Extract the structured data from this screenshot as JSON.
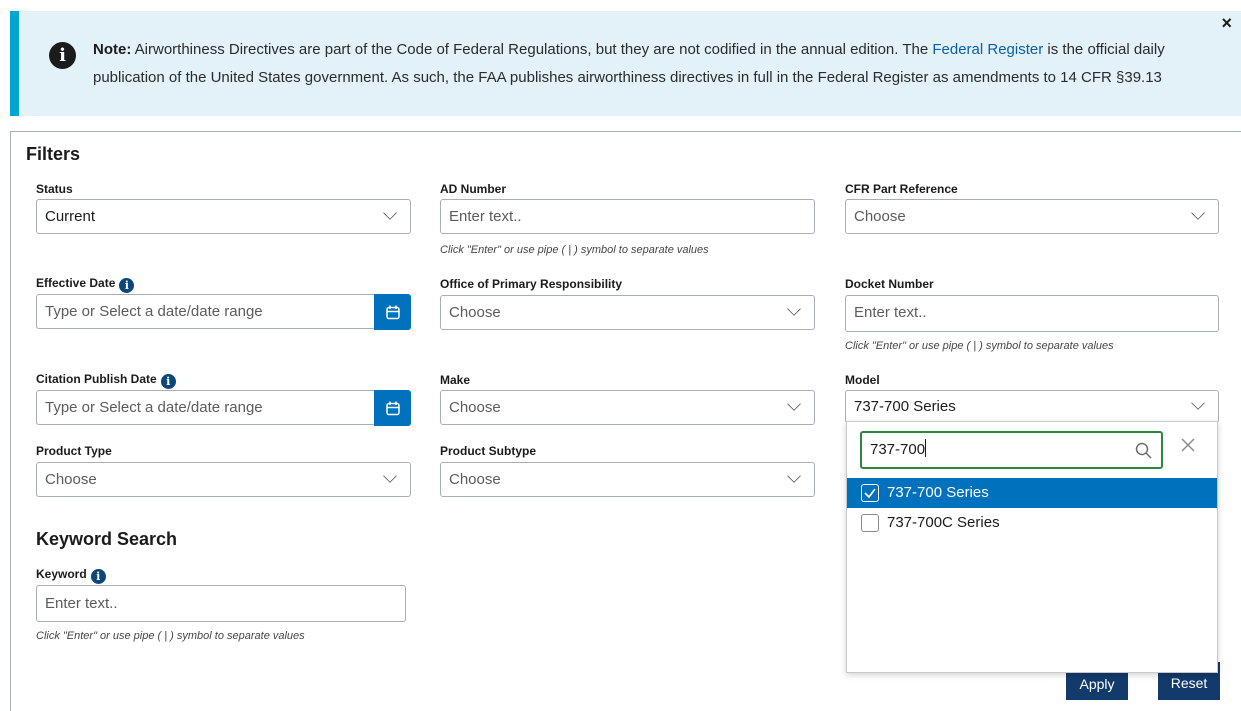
{
  "note": {
    "label": "Note:",
    "text_1": "Airworthiness Directives are part of the Code of Federal Regulations, but they are not codified in the annual edition. The",
    "link": "Federal Register",
    "text_2": "is the official daily publication of the United States government. As such, the FAA publishes airworthiness directives in full in the Federal Register as amendments to 14 CFR §39.13",
    "close": "×"
  },
  "filters": {
    "title": "Filters",
    "status": {
      "label": "Status",
      "value": "Current"
    },
    "ad_number": {
      "label": "AD Number",
      "placeholder": "Enter text..",
      "hint": "Click \"Enter\" or use pipe ( | ) symbol to separate values"
    },
    "cfr_part": {
      "label": "CFR Part Reference",
      "placeholder": "Choose"
    },
    "effective_date": {
      "label": "Effective Date",
      "placeholder": "Type or Select a date/date range"
    },
    "office": {
      "label": "Office of Primary Responsibility",
      "placeholder": "Choose"
    },
    "docket": {
      "label": "Docket Number",
      "placeholder": "Enter text..",
      "hint": "Click \"Enter\" or use pipe ( | ) symbol to separate values"
    },
    "citation_date": {
      "label": "Citation Publish Date",
      "placeholder": "Type or Select a date/date range"
    },
    "make": {
      "label": "Make",
      "placeholder": "Choose"
    },
    "model": {
      "label": "Model",
      "value": "737-700 Series"
    },
    "product_type": {
      "label": "Product Type",
      "placeholder": "Choose"
    },
    "product_subtype": {
      "label": "Product Subtype",
      "placeholder": "Choose"
    }
  },
  "keyword_search": {
    "title": "Keyword Search",
    "label": "Keyword",
    "placeholder": "Enter text..",
    "hint": "Click \"Enter\" or use pipe ( | ) symbol to separate values"
  },
  "model_dropdown": {
    "search_value": "737-700",
    "options": [
      {
        "label": "737-700 Series",
        "checked": true
      },
      {
        "label": "737-700C Series",
        "checked": false
      }
    ]
  },
  "buttons": {
    "apply": "Apply",
    "reset": "Reset"
  },
  "colors": {
    "accent": "#0071bc",
    "navy": "#123a6b",
    "note_bg": "#e3f1f8",
    "note_bar": "#00a6d2",
    "focus": "#2e8540"
  }
}
